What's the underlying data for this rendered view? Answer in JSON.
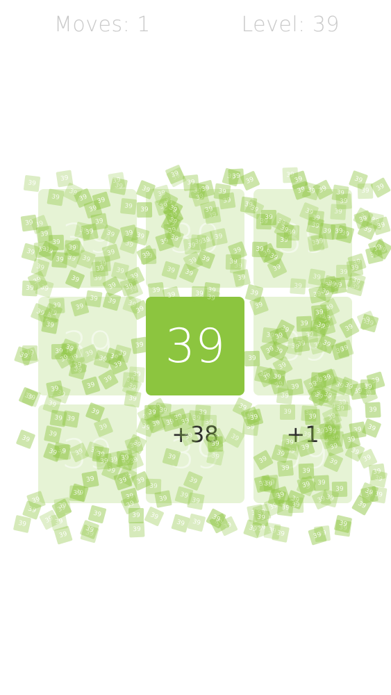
{
  "hud": {
    "moves_text": "Moves: 1",
    "level_text": "Level: 39"
  },
  "board": {
    "tiles": [
      {
        "id": "r1c1",
        "label": "39",
        "state": "faded"
      },
      {
        "id": "r1c2",
        "label": "39",
        "state": "faded"
      },
      {
        "id": "r1c3",
        "label": "39",
        "state": "faded"
      },
      {
        "id": "r2c1",
        "label": "39",
        "state": "faded"
      },
      {
        "id": "r2c2",
        "label": "39",
        "state": "active"
      },
      {
        "id": "r2c3",
        "label": "39",
        "state": "faded"
      },
      {
        "id": "r3c1",
        "label": "39",
        "state": "faded"
      },
      {
        "id": "r3c2",
        "label": "39",
        "state": "faded",
        "delta": "+38"
      },
      {
        "id": "r3c3",
        "label": "39",
        "state": "faded",
        "delta": "+1"
      }
    ]
  },
  "confetti": {
    "chip_label": "39",
    "color": "#8cc53f"
  },
  "colors": {
    "accent": "#8cc53f",
    "hud_text": "#c9c9c9",
    "tile_faded": "#e3f0d2"
  }
}
